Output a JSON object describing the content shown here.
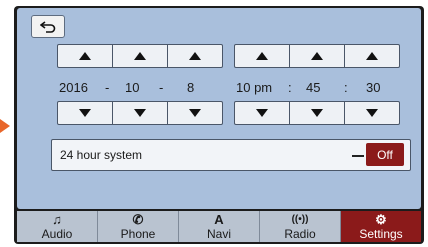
{
  "header": {
    "back_icon": "back-arrow-icon"
  },
  "date": {
    "year": "2016",
    "sep1": "-",
    "month": "10",
    "sep2": "-",
    "day": "8"
  },
  "time": {
    "hour": "10 pm",
    "sep1": ":",
    "minute": "45",
    "sep2": ":",
    "second": "30"
  },
  "toggle": {
    "label": "24 hour system",
    "state": "Off",
    "active_color": "#8b1a1a"
  },
  "nav": [
    {
      "label": "Audio",
      "icon": "music-note-icon",
      "glyph": "♫"
    },
    {
      "label": "Phone",
      "icon": "phone-icon",
      "glyph": "✆"
    },
    {
      "label": "Navi",
      "icon": "navigation-icon",
      "glyph": "A"
    },
    {
      "label": "Radio",
      "icon": "radio-signal-icon",
      "glyph": "((•))"
    },
    {
      "label": "Settings",
      "icon": "gears-icon",
      "glyph": "⚙"
    }
  ],
  "colors": {
    "panel": "#a9bfdc",
    "frame": "#1c1c1c",
    "accent": "#8b1a1a"
  }
}
